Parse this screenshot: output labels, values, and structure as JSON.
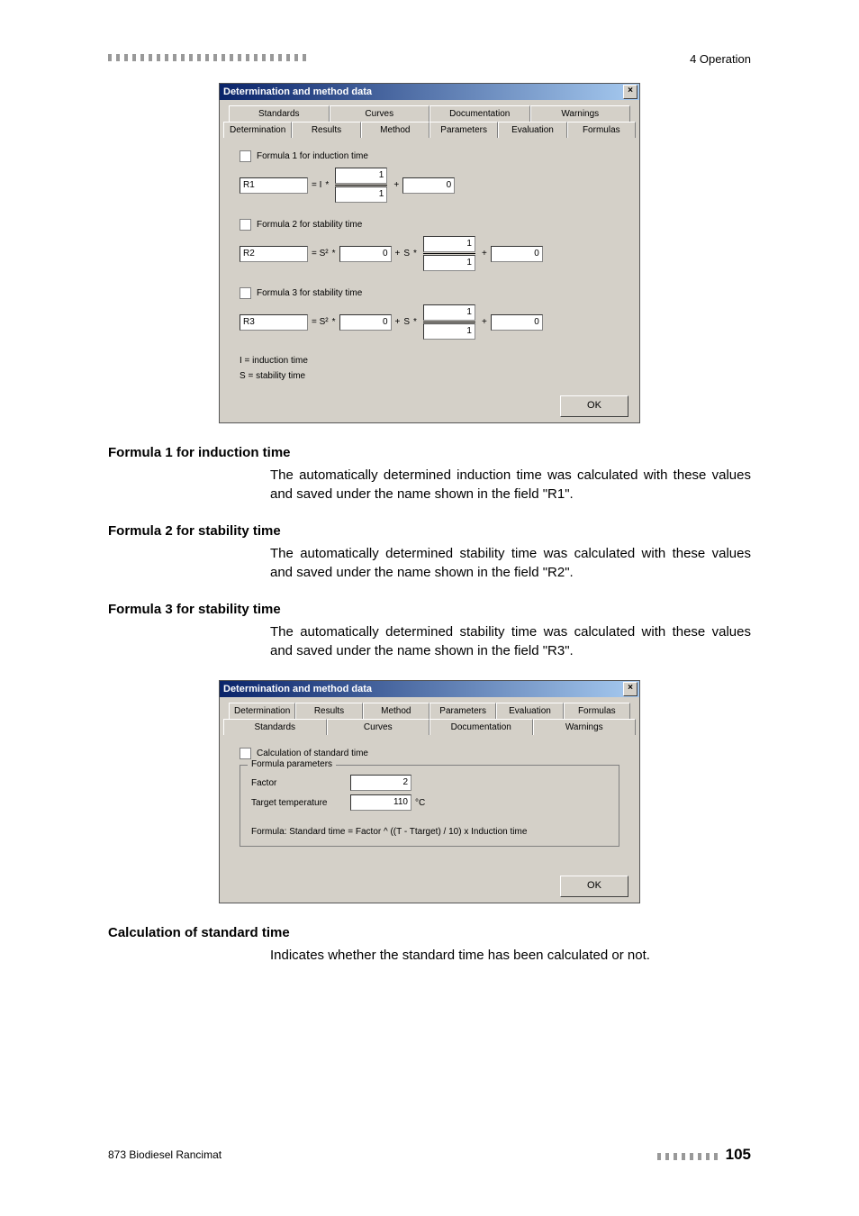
{
  "header": {
    "section": "4 Operation"
  },
  "dialog1": {
    "title": "Determination and method data",
    "tabs_back": [
      "Standards",
      "Curves",
      "Documentation",
      "Warnings"
    ],
    "tabs_front": [
      "Determination",
      "Results",
      "Method",
      "Parameters",
      "Evaluation",
      "Formulas"
    ],
    "formula1": {
      "chk_label": "Formula 1 for induction time",
      "name": "R1",
      "eq_prefix": "= I",
      "star": "*",
      "num": "1",
      "den": "1",
      "plus": "+",
      "const": "0"
    },
    "formula2": {
      "chk_label": "Formula 2 for stability time",
      "name": "R2",
      "eq_prefix": "= S²",
      "star": "*",
      "a": "0",
      "plus1": "+",
      "s": "S",
      "star2": "*",
      "num": "1",
      "den": "1",
      "plus2": "+",
      "const": "0"
    },
    "formula3": {
      "chk_label": "Formula 3 for stability time",
      "name": "R3",
      "eq_prefix": "= S²",
      "star": "*",
      "a": "0",
      "plus1": "+",
      "s": "S",
      "star2": "*",
      "num": "1",
      "den": "1",
      "plus2": "+",
      "const": "0"
    },
    "note_i": "I = induction time",
    "note_s": "S = stability time",
    "ok": "OK"
  },
  "sections": {
    "f1": {
      "title": "Formula 1 for induction time",
      "body": "The automatically determined induction time was calculated with these values and saved under the name shown in the field \"R1\"."
    },
    "f2": {
      "title": "Formula 2 for stability time",
      "body": "The automatically determined stability time was calculated with these values and saved under the name shown in the field \"R2\"."
    },
    "f3": {
      "title": "Formula 3 for stability time",
      "body": "The automatically determined stability time was calculated with these values and saved under the name shown in the field \"R3\"."
    },
    "calc": {
      "title": "Calculation of standard time",
      "body": "Indicates whether the standard time has been calculated or not."
    }
  },
  "dialog2": {
    "title": "Determination and method data",
    "tabs_back": [
      "Determination",
      "Results",
      "Method",
      "Parameters",
      "Evaluation",
      "Formulas"
    ],
    "tabs_front": [
      "Standards",
      "Curves",
      "Documentation",
      "Warnings"
    ],
    "chk_label": "Calculation of standard time",
    "legend": "Formula parameters",
    "factor_label": "Factor",
    "factor_value": "2",
    "target_label": "Target temperature",
    "target_value": "110",
    "target_unit": "°C",
    "formula_text": "Formula: Standard time = Factor ^ ((T - Ttarget) / 10) x  Induction time",
    "ok": "OK"
  },
  "footer": {
    "product": "873 Biodiesel Rancimat",
    "page": "105"
  }
}
